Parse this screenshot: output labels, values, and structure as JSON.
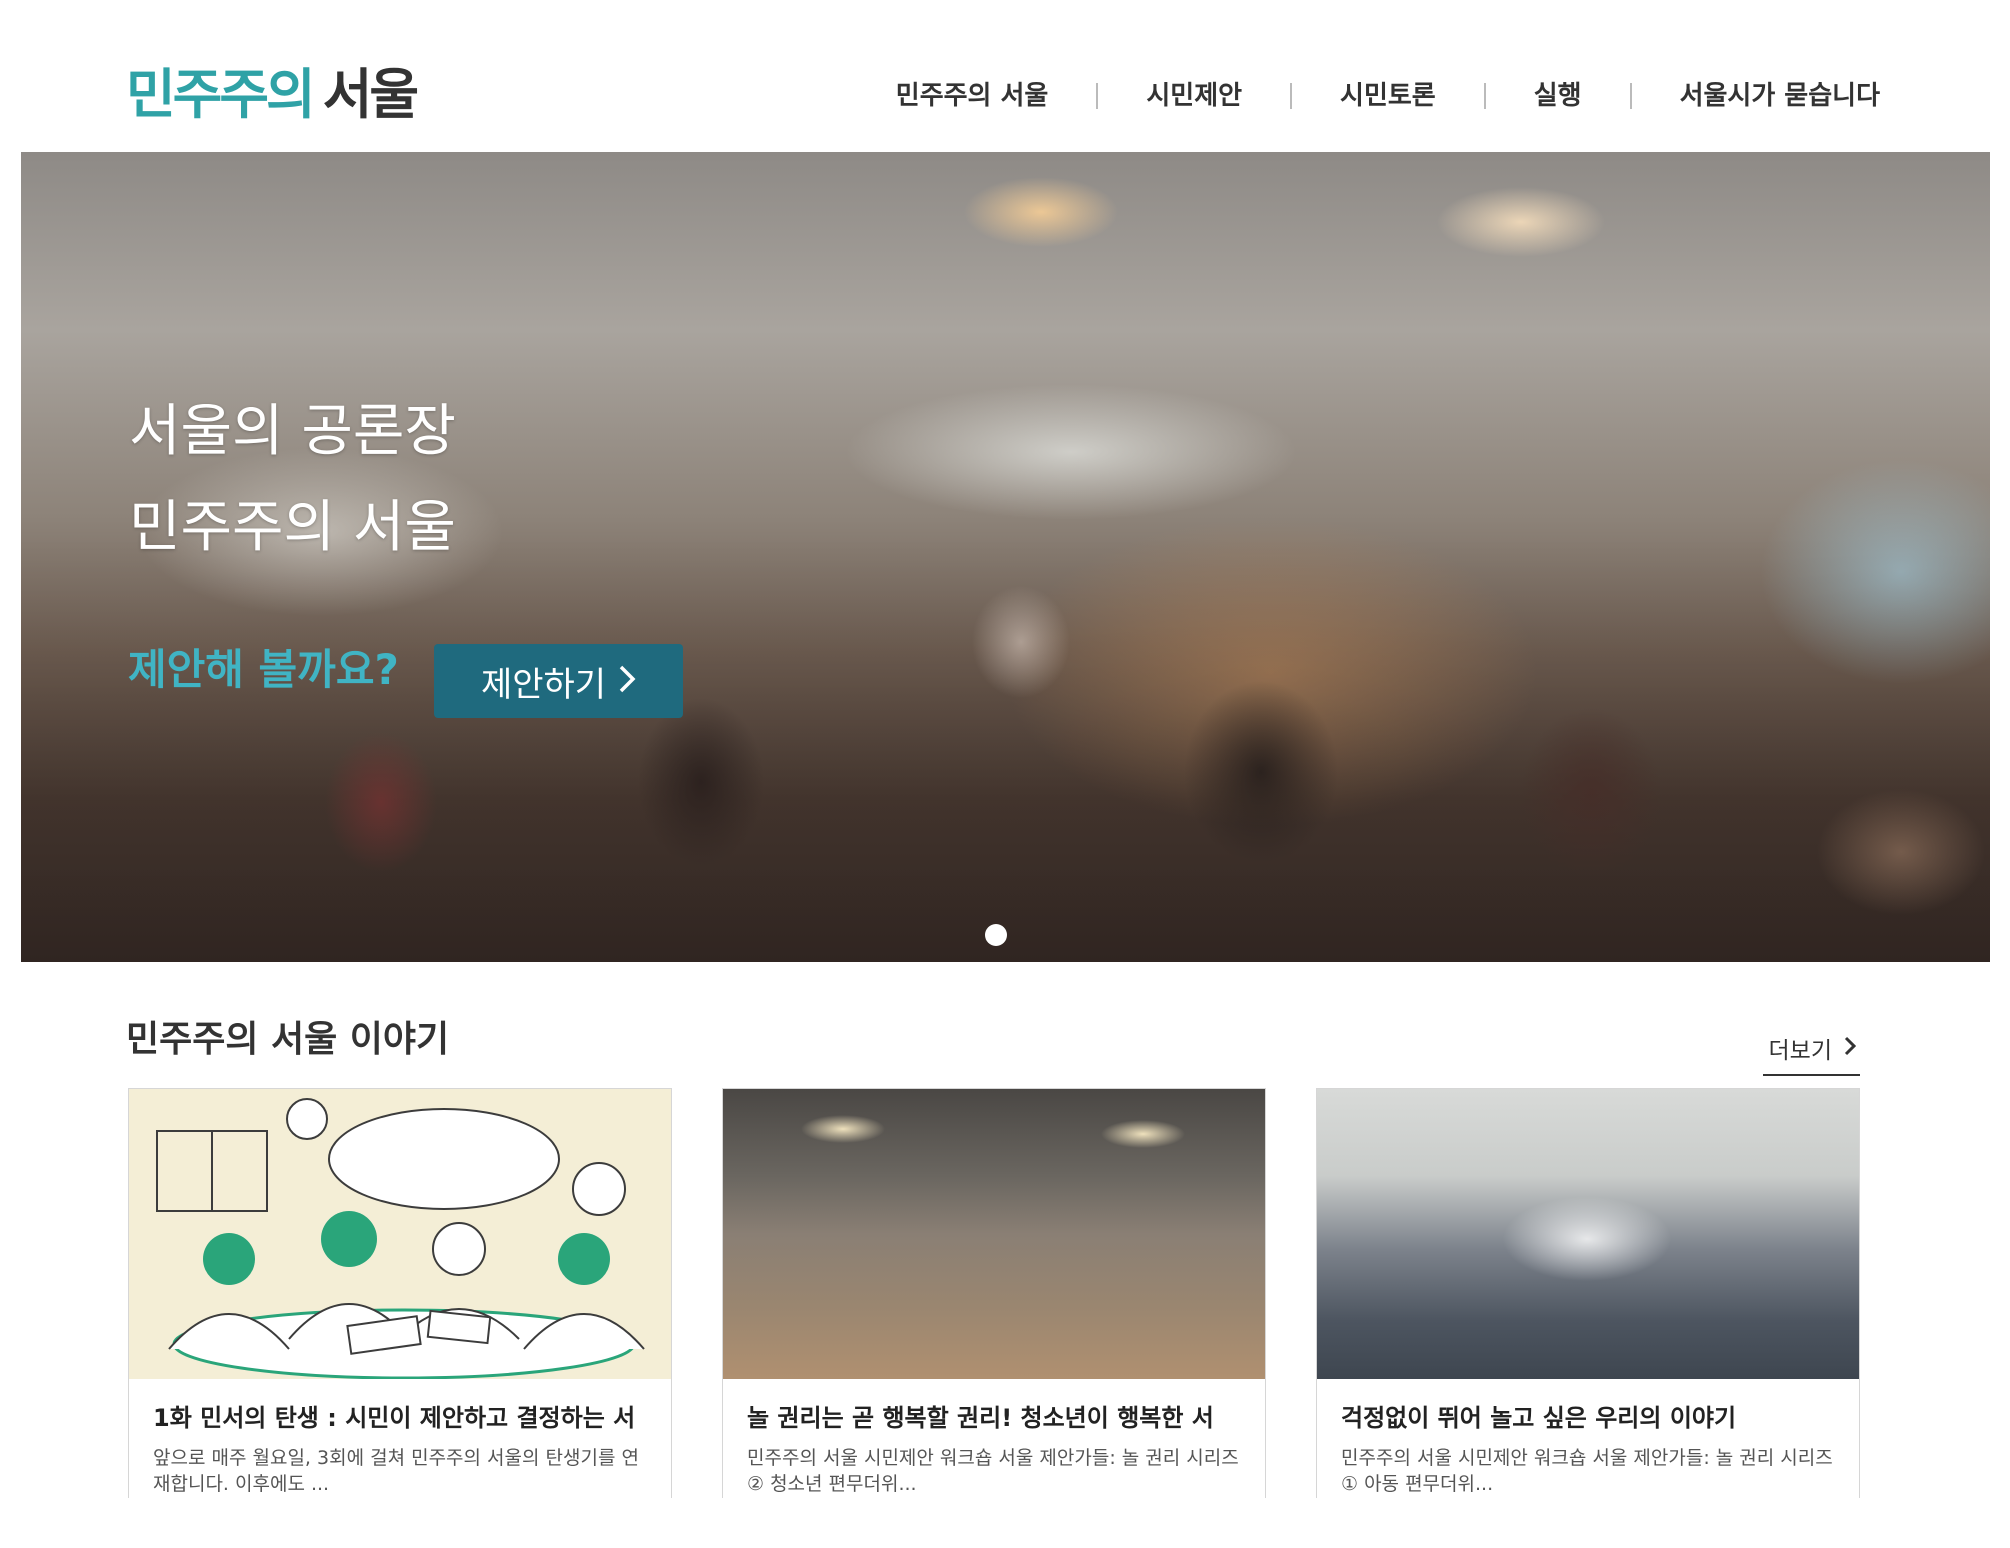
{
  "header": {
    "logo_accent": "민주주의",
    "logo_dark": "서울",
    "nav": [
      "민주주의 서울",
      "시민제안",
      "시민토론",
      "실행",
      "서울시가 묻습니다"
    ]
  },
  "hero": {
    "title_line1": "서울의 공론장",
    "title_line2": "민주주의 서울",
    "prompt": "제안해 볼까요?",
    "cta_label": "제안하기",
    "cta_icon": "chevron-right-icon",
    "slide_indicator": "1"
  },
  "stories": {
    "title": "민주주의 서울 이야기",
    "more_label": "더보기",
    "cards": [
      {
        "title": "1화 민서의 탄생 : 시민이 제안하고 결정하는 서",
        "desc": "앞으로 매주 월요일, 3회에 걸쳐 민주주의 서울의 탄생기를 연재합니다. 이후에도 ...",
        "image": "illustration-people-discussing"
      },
      {
        "title": "놀 권리는 곧 행복할 권리! 청소년이 행복한 서",
        "desc": "민주주의 서울 시민제안 워크숍 서울 제안가들: 놀 권리 시리즈 ② 청소년 편무더위...",
        "image": "photo-workshop-group"
      },
      {
        "title": "걱정없이 뛰어 놀고 싶은 우리의 이야기",
        "desc": "민주주의 서울 시민제안 워크숍 서울 제안가들: 놀 권리 시리즈 ① 아동 편무더위...",
        "image": "photo-children-workshop"
      }
    ]
  },
  "colors": {
    "brand_teal": "#2fa2a6",
    "cta_bg": "#1f6a7e",
    "prompt_text": "#40b4c4"
  }
}
